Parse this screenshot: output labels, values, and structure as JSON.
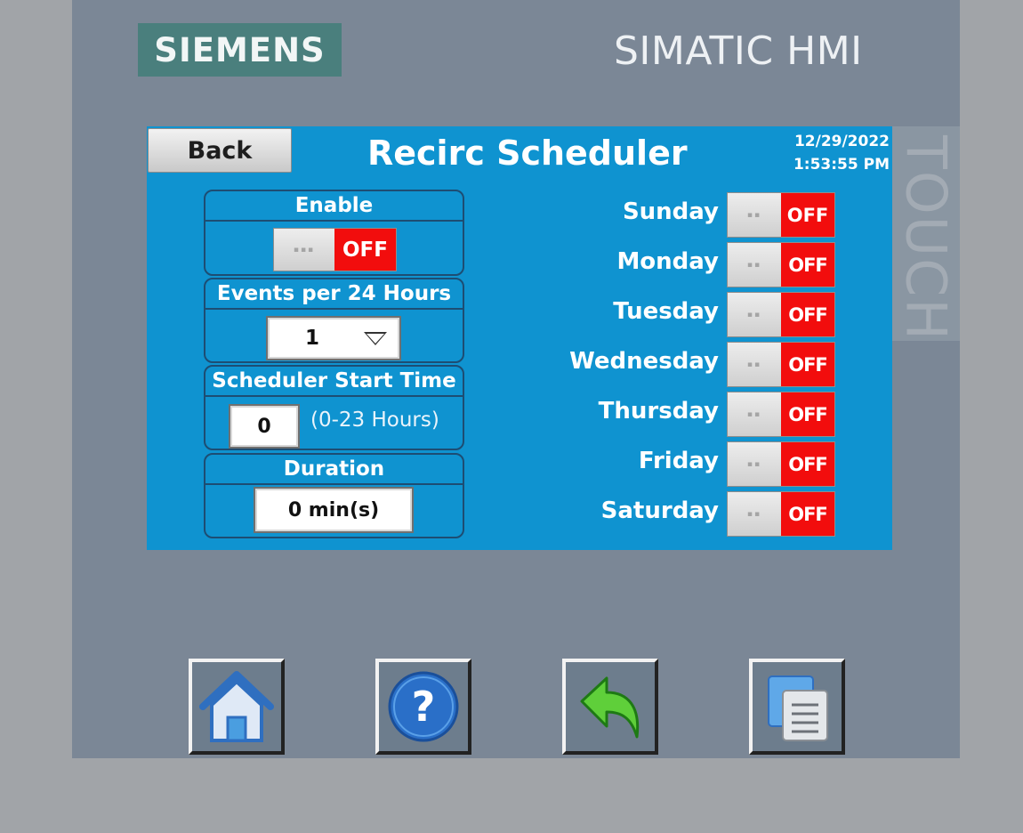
{
  "device": {
    "brand": "SIEMENS",
    "product": "SIMATIC HMI",
    "side_label": "TOUCH"
  },
  "header": {
    "back_label": "Back",
    "title": "Recirc Scheduler",
    "date": "12/29/2022",
    "time": "1:53:55 PM"
  },
  "enable": {
    "title": "Enable",
    "state": "OFF"
  },
  "events": {
    "title": "Events per 24 Hours",
    "value": "1"
  },
  "start_time": {
    "title": "Scheduler Start Time",
    "value": "0",
    "hint": "(0-23 Hours)"
  },
  "duration": {
    "title": "Duration",
    "value": "0 min(s)"
  },
  "days": [
    {
      "label": "Sunday",
      "state": "OFF"
    },
    {
      "label": "Monday",
      "state": "OFF"
    },
    {
      "label": "Tuesday",
      "state": "OFF"
    },
    {
      "label": "Wednesday",
      "state": "OFF"
    },
    {
      "label": "Thursday",
      "state": "OFF"
    },
    {
      "label": "Friday",
      "state": "OFF"
    },
    {
      "label": "Saturday",
      "state": "OFF"
    }
  ],
  "hardware_buttons": [
    {
      "icon": "home-icon"
    },
    {
      "icon": "help-icon"
    },
    {
      "icon": "back-arrow-icon"
    },
    {
      "icon": "screens-icon"
    }
  ],
  "colors": {
    "screen": "#0f93d0",
    "off_state": "#f20d0d",
    "bezel": "#7b8796",
    "logo": "#4a7f7d"
  }
}
